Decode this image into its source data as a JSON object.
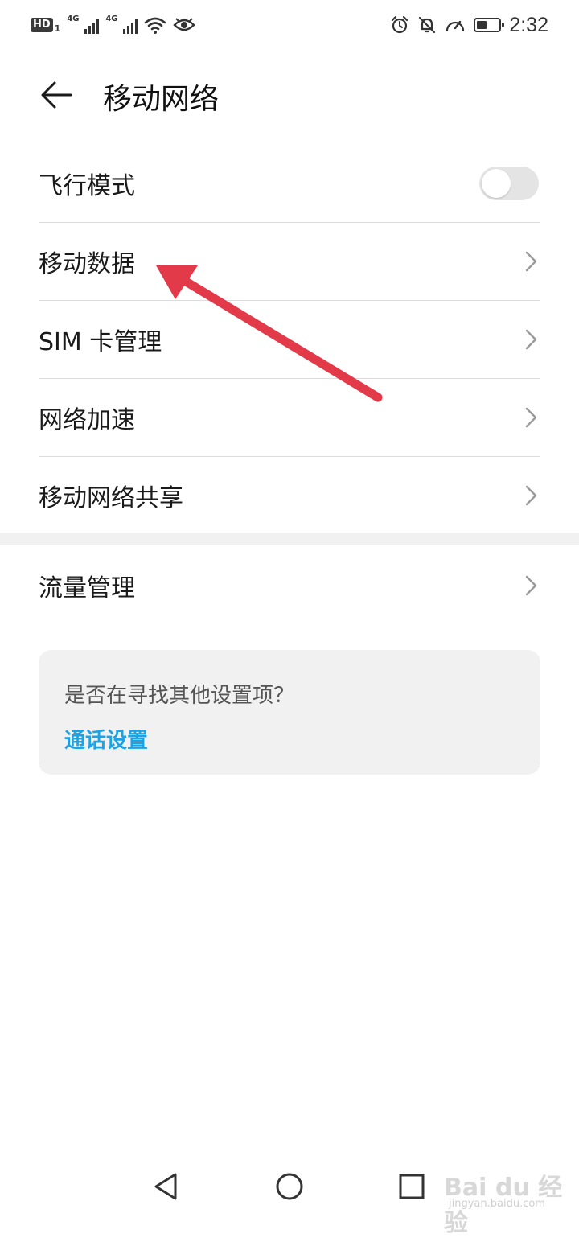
{
  "status_bar": {
    "hd": "HD",
    "hd_sub": "1",
    "sim1_type": "4G",
    "sim2_type": "4G",
    "time": "2:32",
    "battery_level": 0.45,
    "icons": [
      "signal-icon",
      "wifi-icon",
      "eye-icon",
      "alarm-icon",
      "mute-bell-icon",
      "speed-icon",
      "battery-icon"
    ]
  },
  "header": {
    "title": "移动网络"
  },
  "section1": [
    {
      "label": "飞行模式",
      "control": "toggle",
      "on": false
    },
    {
      "label": "移动数据",
      "control": "chevron"
    },
    {
      "label": "SIM 卡管理",
      "control": "chevron"
    },
    {
      "label": "网络加速",
      "control": "chevron"
    },
    {
      "label": "移动网络共享",
      "control": "chevron"
    }
  ],
  "section2": [
    {
      "label": "流量管理",
      "control": "chevron"
    }
  ],
  "suggest": {
    "question": "是否在寻找其他设置项？",
    "link": "通话设置"
  },
  "watermark": {
    "logo": "Bai du 经验",
    "url": "jingyan.baidu.com"
  },
  "colors": {
    "accent_link": "#1aa3e6",
    "annotation_arrow": "#e33a4a",
    "toggle_off": "#e4e4e4"
  }
}
